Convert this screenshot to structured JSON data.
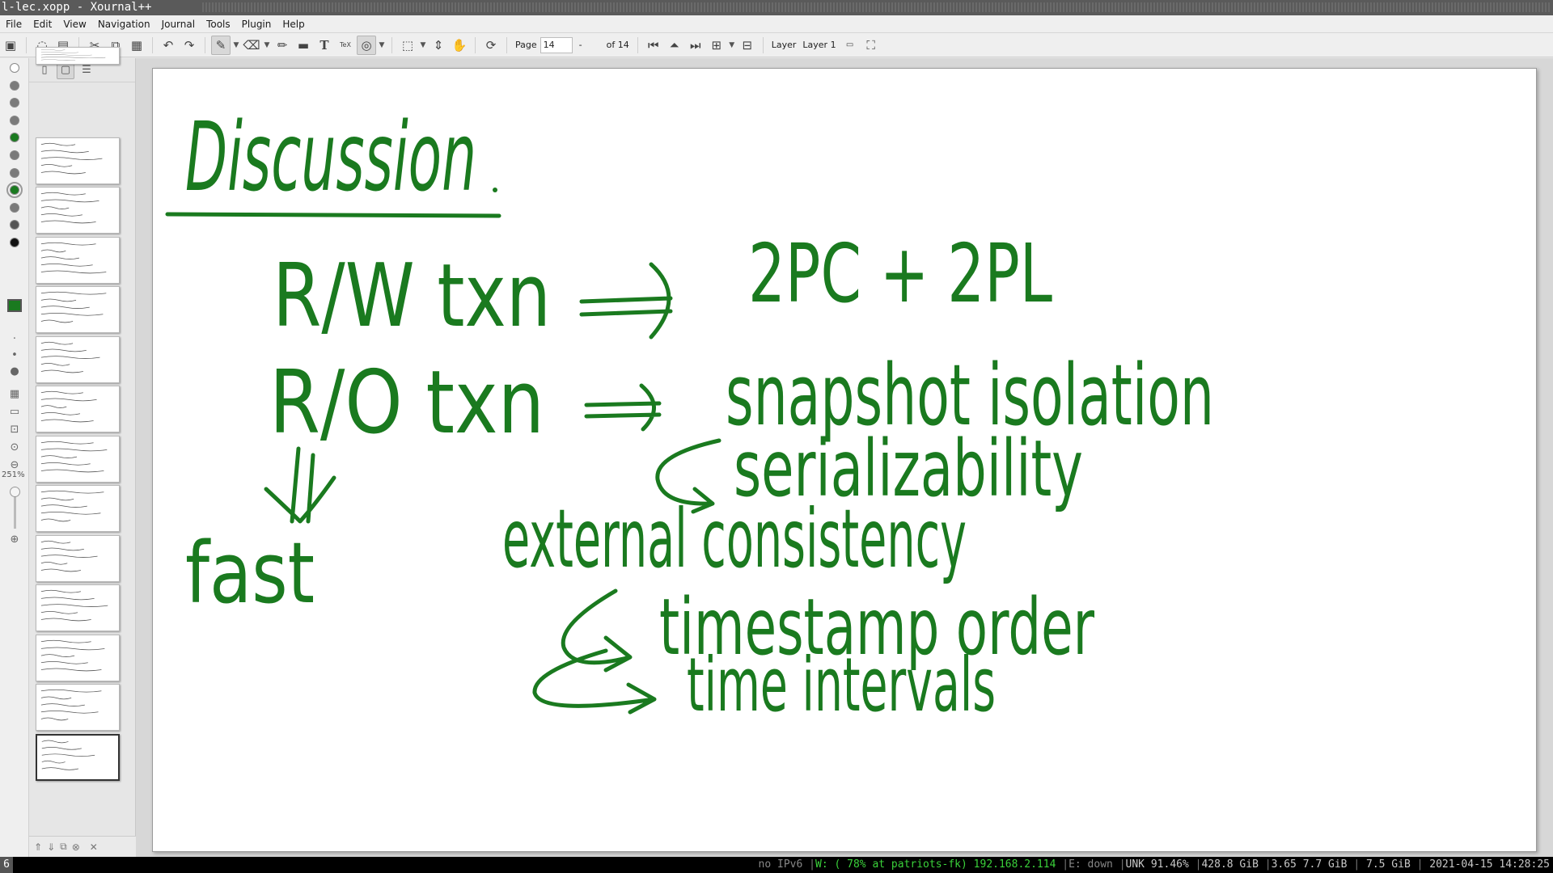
{
  "window": {
    "title": "l-lec.xopp - Xournal++"
  },
  "menu": [
    "File",
    "Edit",
    "View",
    "Navigation",
    "Journal",
    "Tools",
    "Plugin",
    "Help"
  ],
  "toolbar": {
    "page_label": "Page",
    "page_value": "14",
    "page_sep": "-",
    "page_of": "of 14",
    "layer_label": "Layer",
    "layer_value": "Layer 1"
  },
  "left_tools": {
    "zoom_label": "251%",
    "colors": [
      "#ffffff",
      "#7a7a7a",
      "#7a7a7a",
      "#7a7a7a",
      "#1a7a1f",
      "#7a7a7a",
      "#7a7a7a",
      "#1a7a1f",
      "#7a7a7a",
      "#555555",
      "#111111"
    ],
    "selected_color": "#1a7a1f"
  },
  "sidebar": {
    "page_count": 14,
    "current_page": 14
  },
  "note": {
    "ink_color": "#1a7a1f",
    "title": "Discussion",
    "lines": [
      "R/W txn",
      "2PC + 2PL",
      "R/O txn",
      "snapshot isolation",
      "serializability",
      "fast",
      "external consistency",
      "timestamp order",
      "time intervals"
    ]
  },
  "status": {
    "workspace": "6",
    "ipv6": "no IPv6",
    "wifi": "W: ( 78% at patriots-fk) 192.168.2.114",
    "eth": "E: down",
    "battery": "UNK 91.46%",
    "disk": "428.8 GiB",
    "load": "3.65",
    "mem_used": "7.7 GiB",
    "mem_total": "7.5 GiB",
    "datetime": "2021-04-15 14:28:25"
  }
}
